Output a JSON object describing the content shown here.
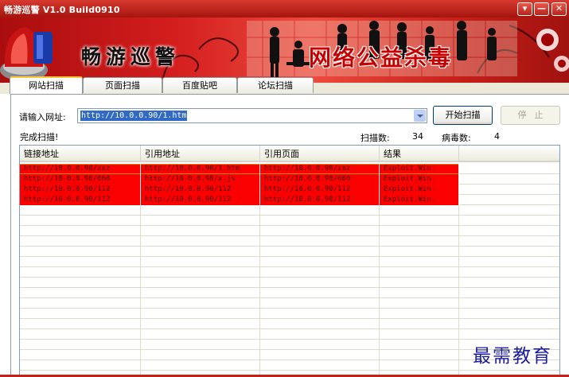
{
  "window": {
    "title": "畅游巡警 V1.0 Build0910",
    "controls": {
      "menu": "▾",
      "minimize": "—",
      "close": "✕"
    }
  },
  "banner": {
    "brand": "畅游巡警",
    "caption": "网络公益杀毒",
    "colors": {
      "primary": "#c7201a",
      "caption": "#c40000"
    }
  },
  "tabs": [
    {
      "label": "网站扫描",
      "active": true
    },
    {
      "label": "页面扫描",
      "active": false
    },
    {
      "label": "百度贴吧",
      "active": false
    },
    {
      "label": "论坛扫描",
      "active": false
    }
  ],
  "scan": {
    "url_label": "请输入网址:",
    "url_value": "http://10.0.0.90/1.htm",
    "start_button": "开始扫描",
    "stop_button": "停止",
    "status": "完成扫描!",
    "scan_count_label": "扫描数:",
    "scan_count": "34",
    "virus_count_label": "病毒数:",
    "virus_count": "4"
  },
  "table": {
    "columns": [
      "链接地址",
      "引用地址",
      "引用页面",
      "结果"
    ],
    "rows": [
      [
        "http://10.0.0.90/zaz",
        "http://10.0.0.90/1.htm",
        "http://10.0.0.90/zaz",
        "Exploit.Win."
      ],
      [
        "http://10.0.0.90/060",
        "http://10.0.0.90/x.js",
        "http://10.0.0.90/060",
        "Exploit.Win."
      ],
      [
        "http://10.0.0.90/112",
        "http://10.0.0.90/112",
        "http://10.0.0.90/112",
        "Exploit.Win."
      ],
      [
        "http://10.0.0.90/112",
        "http://10.0.0.90/112",
        "http://10.0.0.90/112",
        "Exploit.Win."
      ]
    ],
    "highlight_color": "#fa0000"
  },
  "watermark": "最需教育"
}
